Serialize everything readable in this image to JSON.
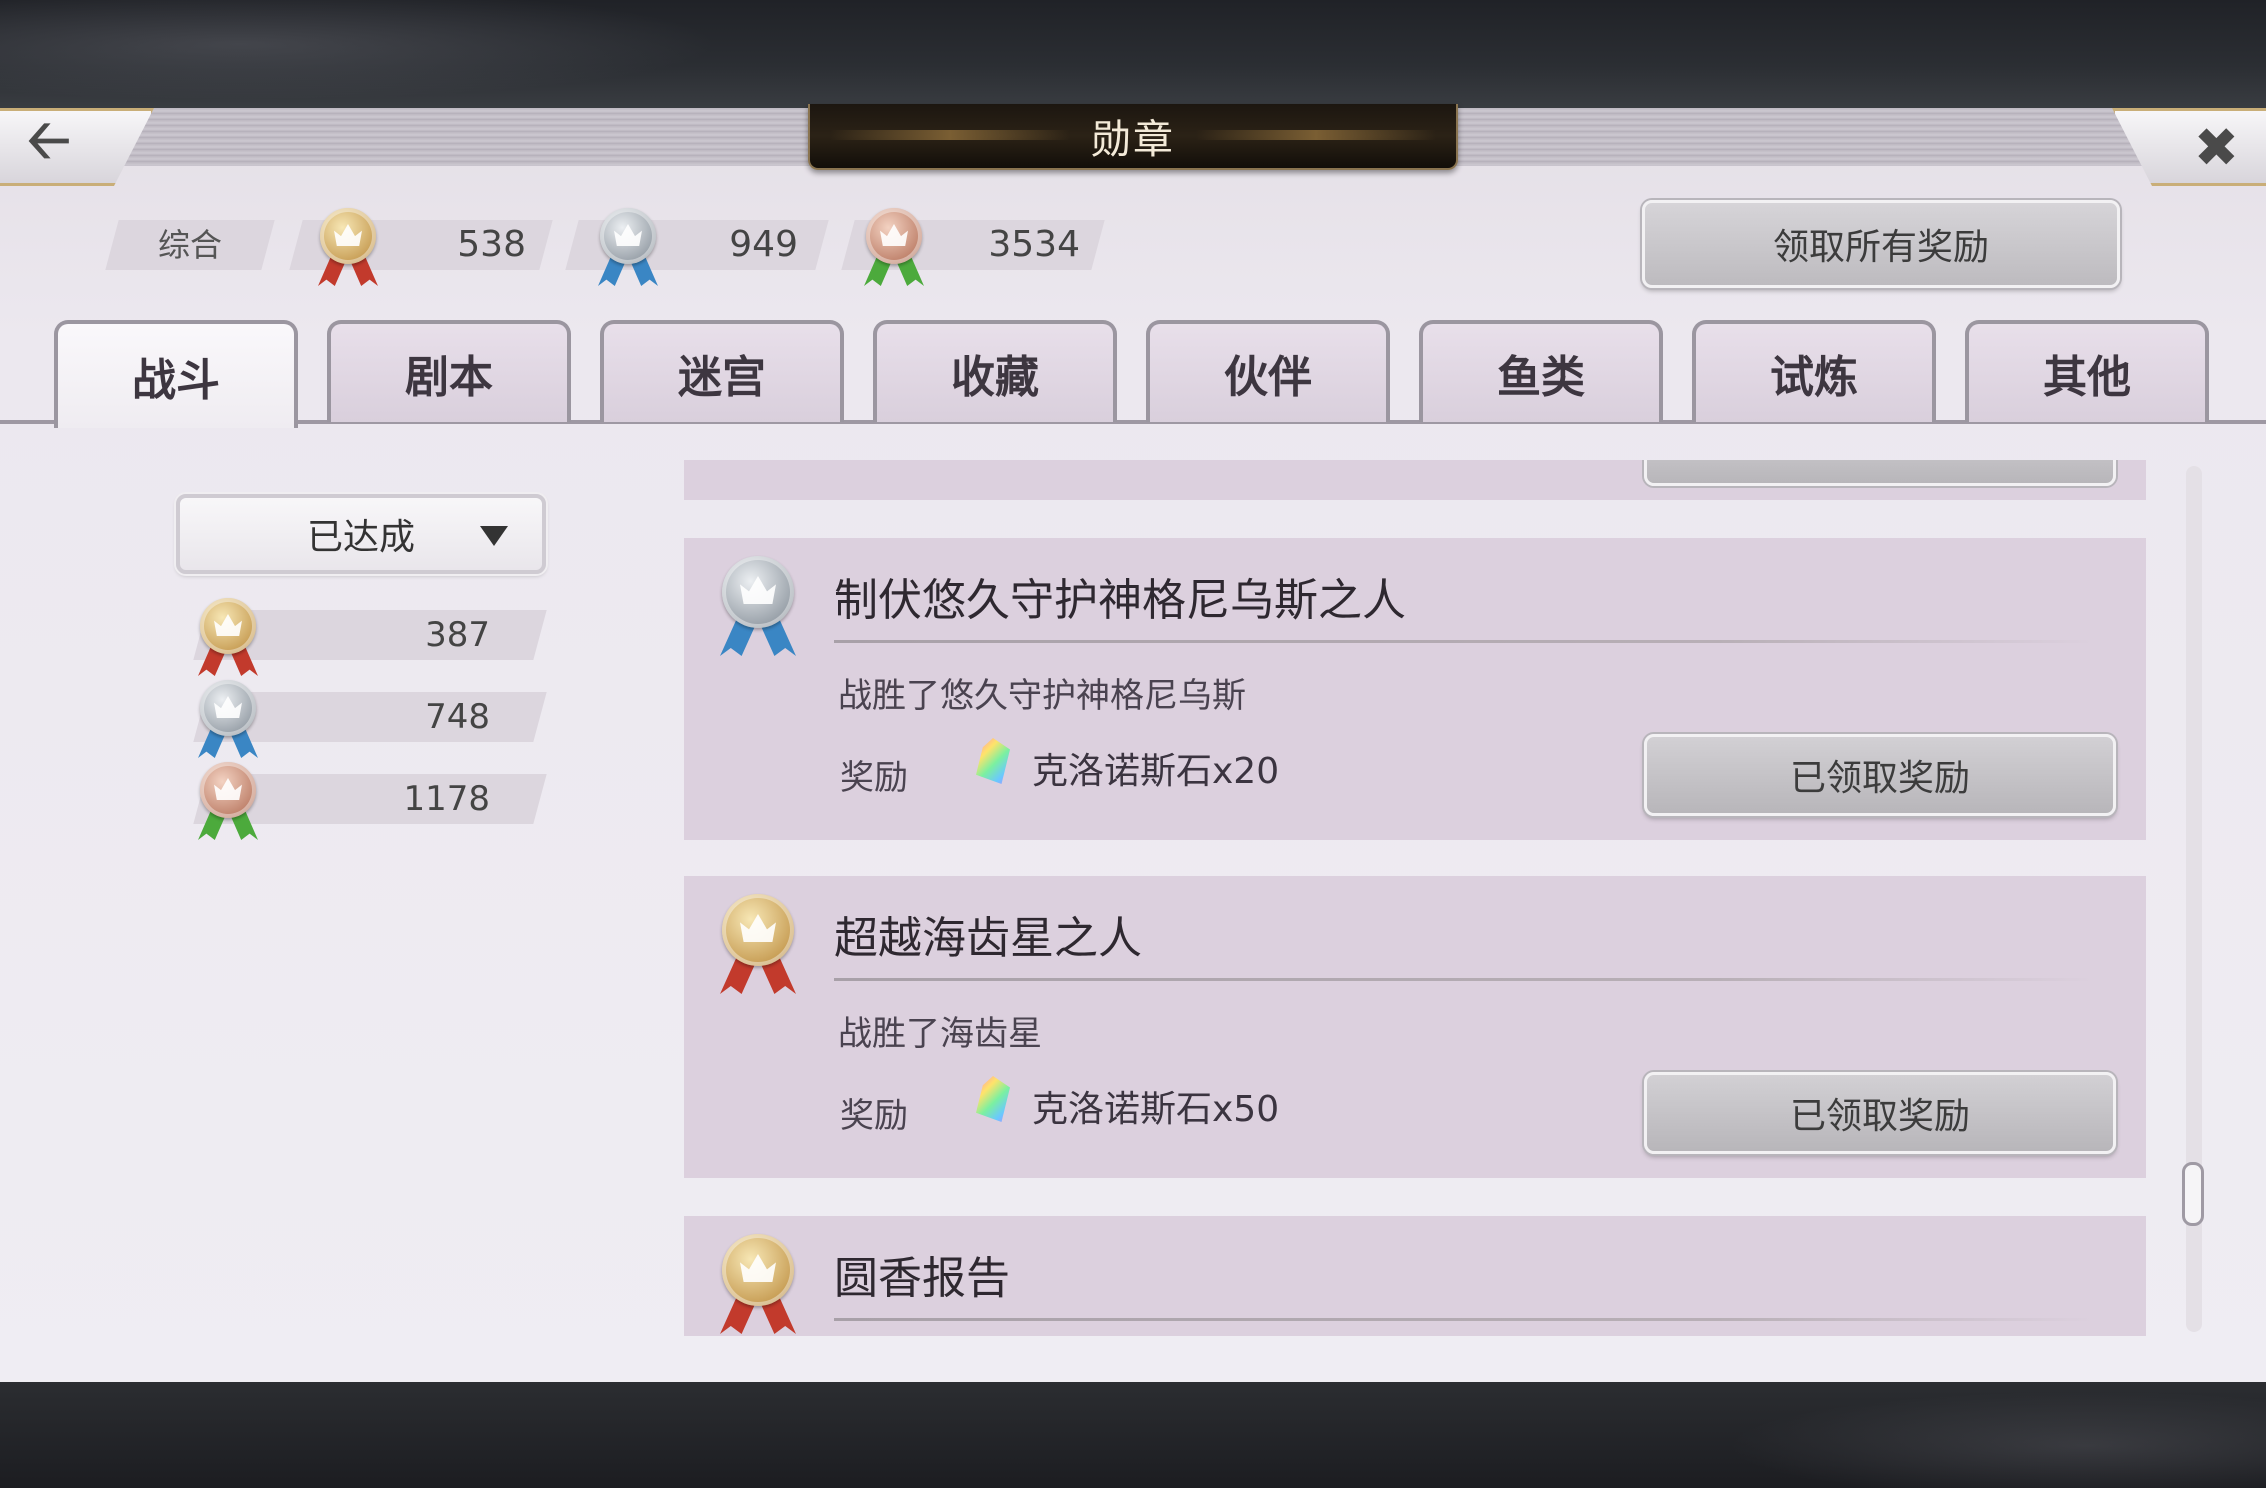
{
  "header": {
    "title": "勋章",
    "back_icon": "arrow-left",
    "close_icon": "x"
  },
  "summary": {
    "label": "综合",
    "gold": "538",
    "silver": "949",
    "bronze": "3534",
    "claim_all_label": "领取所有奖励"
  },
  "tabs": [
    {
      "label": "战斗",
      "active": true
    },
    {
      "label": "剧本",
      "active": false
    },
    {
      "label": "迷宫",
      "active": false
    },
    {
      "label": "收藏",
      "active": false
    },
    {
      "label": "伙伴",
      "active": false
    },
    {
      "label": "鱼类",
      "active": false
    },
    {
      "label": "试炼",
      "active": false
    },
    {
      "label": "其他",
      "active": false
    }
  ],
  "filter": {
    "selected": "已达成",
    "gold": "387",
    "silver": "748",
    "bronze": "1178"
  },
  "achievements": [
    {
      "medal": "silver",
      "title": "制伏悠久守护神格尼乌斯之人",
      "description": "战胜了悠久守护神格尼乌斯",
      "reward_label": "奖励",
      "reward": "克洛诺斯石x20",
      "button": "已领取奖励"
    },
    {
      "medal": "gold",
      "title": "超越海齿星之人",
      "description": "战胜了海齿星",
      "reward_label": "奖励",
      "reward": "克洛诺斯石x50",
      "button": "已领取奖励"
    },
    {
      "medal": "gold",
      "title": "圆香报告"
    }
  ],
  "colors": {
    "gold_ribbon": "#c23a2c",
    "silver_ribbon": "#3a86c4",
    "bronze_ribbon": "#4caa3c"
  }
}
